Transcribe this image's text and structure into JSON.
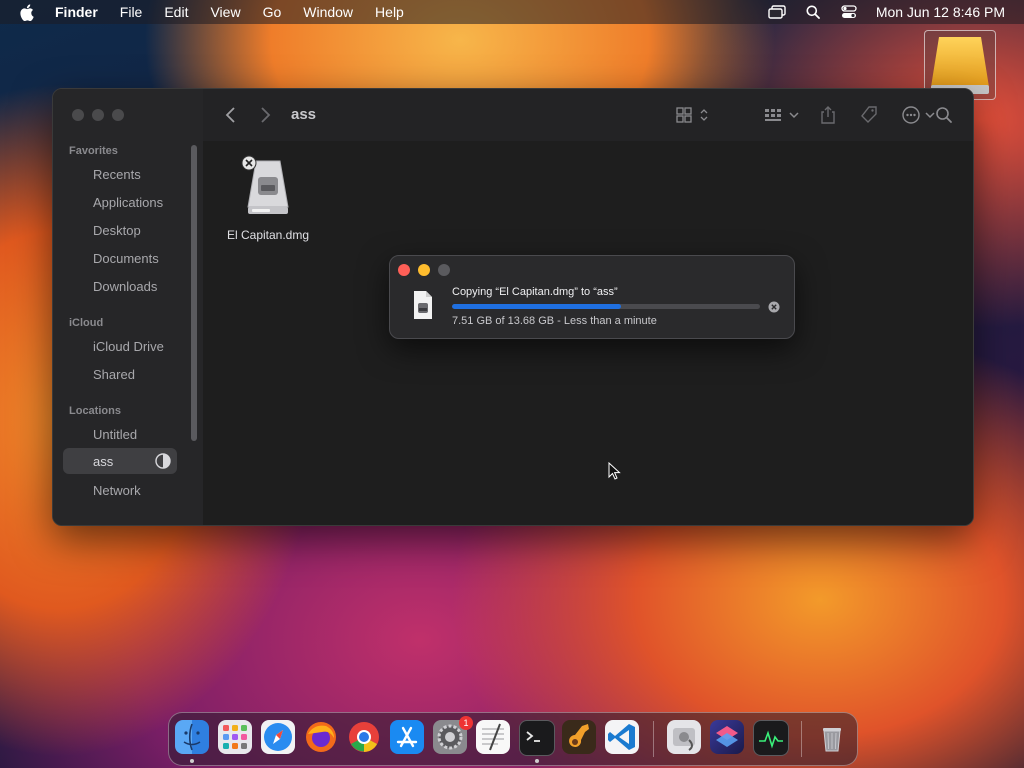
{
  "menubar": {
    "app_name": "Finder",
    "menus": [
      "File",
      "Edit",
      "View",
      "Go",
      "Window",
      "Help"
    ],
    "clock": "Mon Jun 12  8:46 PM"
  },
  "sidebar": {
    "sections": [
      {
        "title": "Favorites",
        "items": [
          "Recents",
          "Applications",
          "Desktop",
          "Documents",
          "Downloads"
        ]
      },
      {
        "title": "iCloud",
        "items": [
          "iCloud Drive",
          "Shared"
        ]
      },
      {
        "title": "Locations",
        "items": [
          "Untitled",
          "ass",
          "Network"
        ]
      }
    ],
    "selected": "ass"
  },
  "toolbar": {
    "title": "ass"
  },
  "files": [
    {
      "name": "El Capitan.dmg"
    }
  ],
  "copy_dialog": {
    "title": "Copying “El Capitan.dmg” to “ass”",
    "status": "7.51 GB of 13.68 GB - Less than a minute",
    "progress_fraction": 0.55
  },
  "dock": {
    "apps": [
      "finder",
      "launchpad",
      "safari",
      "firefox",
      "chrome",
      "app-store",
      "system-settings",
      "textedit",
      "terminal",
      "garageband",
      "vscode",
      "disk-utility",
      "shortcuts",
      "activity-monitor",
      "trash"
    ],
    "settings_badge": "1"
  },
  "colors": {
    "accent": "#1f6fe0",
    "close": "#fe5f57",
    "minimize": "#febc2e"
  }
}
